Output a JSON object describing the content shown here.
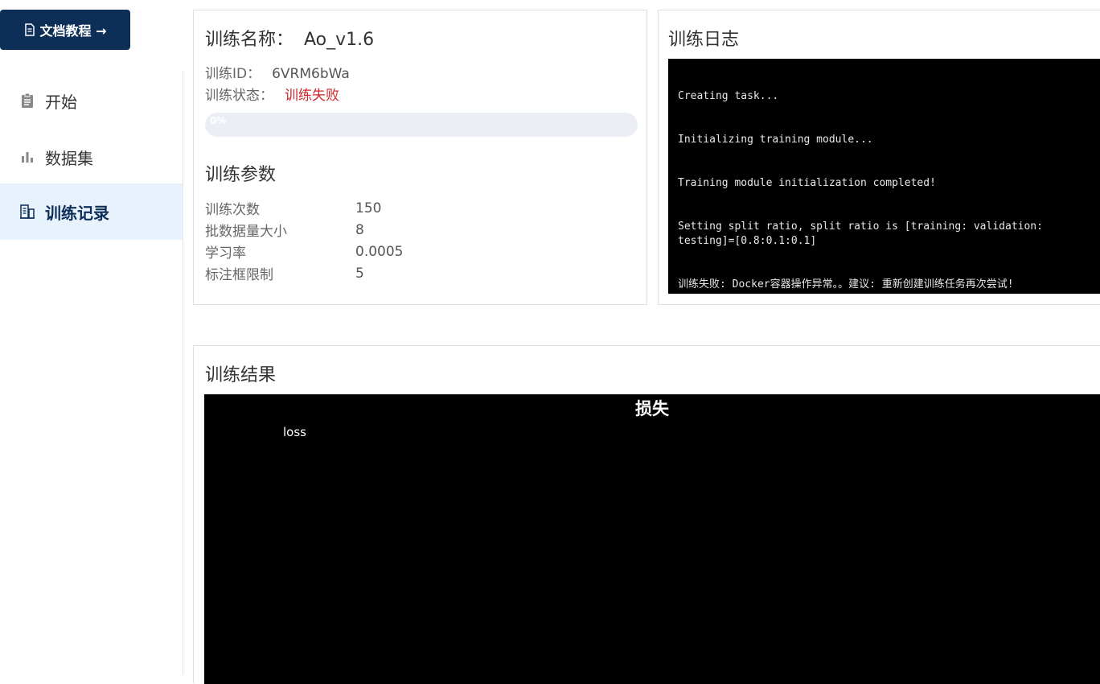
{
  "sidebar": {
    "doc_button": "文档教程 →",
    "items": [
      {
        "label": "开始",
        "icon": "clipboard-icon"
      },
      {
        "label": "数据集",
        "icon": "bar-chart-icon"
      },
      {
        "label": "训练记录",
        "icon": "record-list-icon",
        "active": true
      }
    ]
  },
  "info": {
    "name_label": "训练名称：",
    "name_value": "Ao_v1.6",
    "id_label": "训练ID：",
    "id_value": "6VRM6bWa",
    "status_label": "训练状态：",
    "status_value": "训练失败",
    "progress": 0,
    "progress_text": "0%",
    "params_title": "训练参数",
    "params": [
      {
        "key": "训练次数",
        "value": "150"
      },
      {
        "key": "批数据量大小",
        "value": "8"
      },
      {
        "key": "学习率",
        "value": "0.0005"
      },
      {
        "key": "标注框限制",
        "value": "5"
      }
    ]
  },
  "log": {
    "title": "训练日志",
    "lines": [
      "Creating task...",
      "Initializing training module...",
      "Training module initialization completed!",
      "Setting split ratio, split ratio is [training: validation: testing]=[0.8:0.1:0.1]",
      "训练失败: Docker容器操作异常。。建议: 重新创建训练任务再次尝试!"
    ]
  },
  "result": {
    "title": "训练结果",
    "chart_data": {
      "type": "line",
      "title": "损失",
      "series": [
        {
          "name": "loss",
          "values": []
        }
      ]
    }
  },
  "colors": {
    "primary": "#0d2e57",
    "active_bg": "#e8f2fd",
    "failed": "#d0262b",
    "progress_track": "#ebeff5"
  }
}
